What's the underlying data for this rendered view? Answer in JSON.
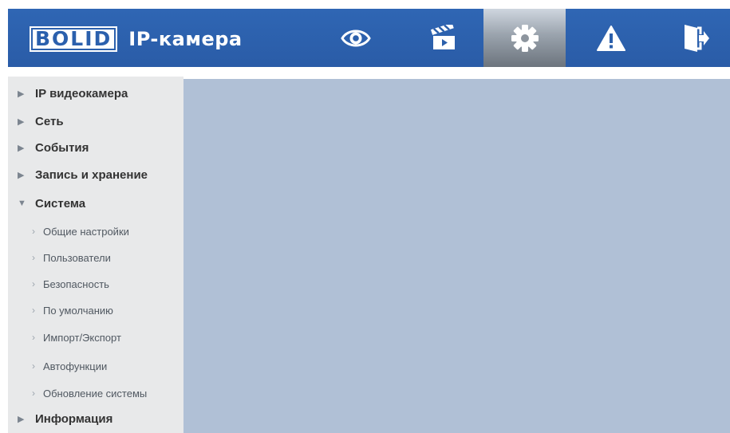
{
  "header": {
    "logo_text": "BOLID",
    "app_title": "IP-камера",
    "nav": [
      {
        "name": "live-view",
        "icon": "eye-icon",
        "active": false
      },
      {
        "name": "playback",
        "icon": "clapperboard-icon",
        "active": false
      },
      {
        "name": "settings",
        "icon": "gear-icon",
        "active": true
      },
      {
        "name": "alarm",
        "icon": "warning-icon",
        "active": false
      },
      {
        "name": "logout",
        "icon": "exit-icon",
        "active": false
      }
    ]
  },
  "sidebar": {
    "items": [
      {
        "label": "IP видеокамера",
        "expanded": false
      },
      {
        "label": "Сеть",
        "expanded": false
      },
      {
        "label": "События",
        "expanded": false
      },
      {
        "label": "Запись и хранение",
        "expanded": false
      },
      {
        "label": "Система",
        "expanded": true
      },
      {
        "label": "Информация",
        "expanded": false
      }
    ],
    "system_sub": [
      {
        "label": "Общие настройки"
      },
      {
        "label": "Пользователи"
      },
      {
        "label": "Безопасность"
      },
      {
        "label": "По умолчанию"
      },
      {
        "label": "Импорт/Экспорт"
      },
      {
        "label": "Автофункции"
      },
      {
        "label": "Обновление системы"
      }
    ]
  },
  "colors": {
    "header_bg": "#2b5fab",
    "content_bg": "#b0c0d6",
    "sidebar_bg": "#e8e9ea"
  }
}
